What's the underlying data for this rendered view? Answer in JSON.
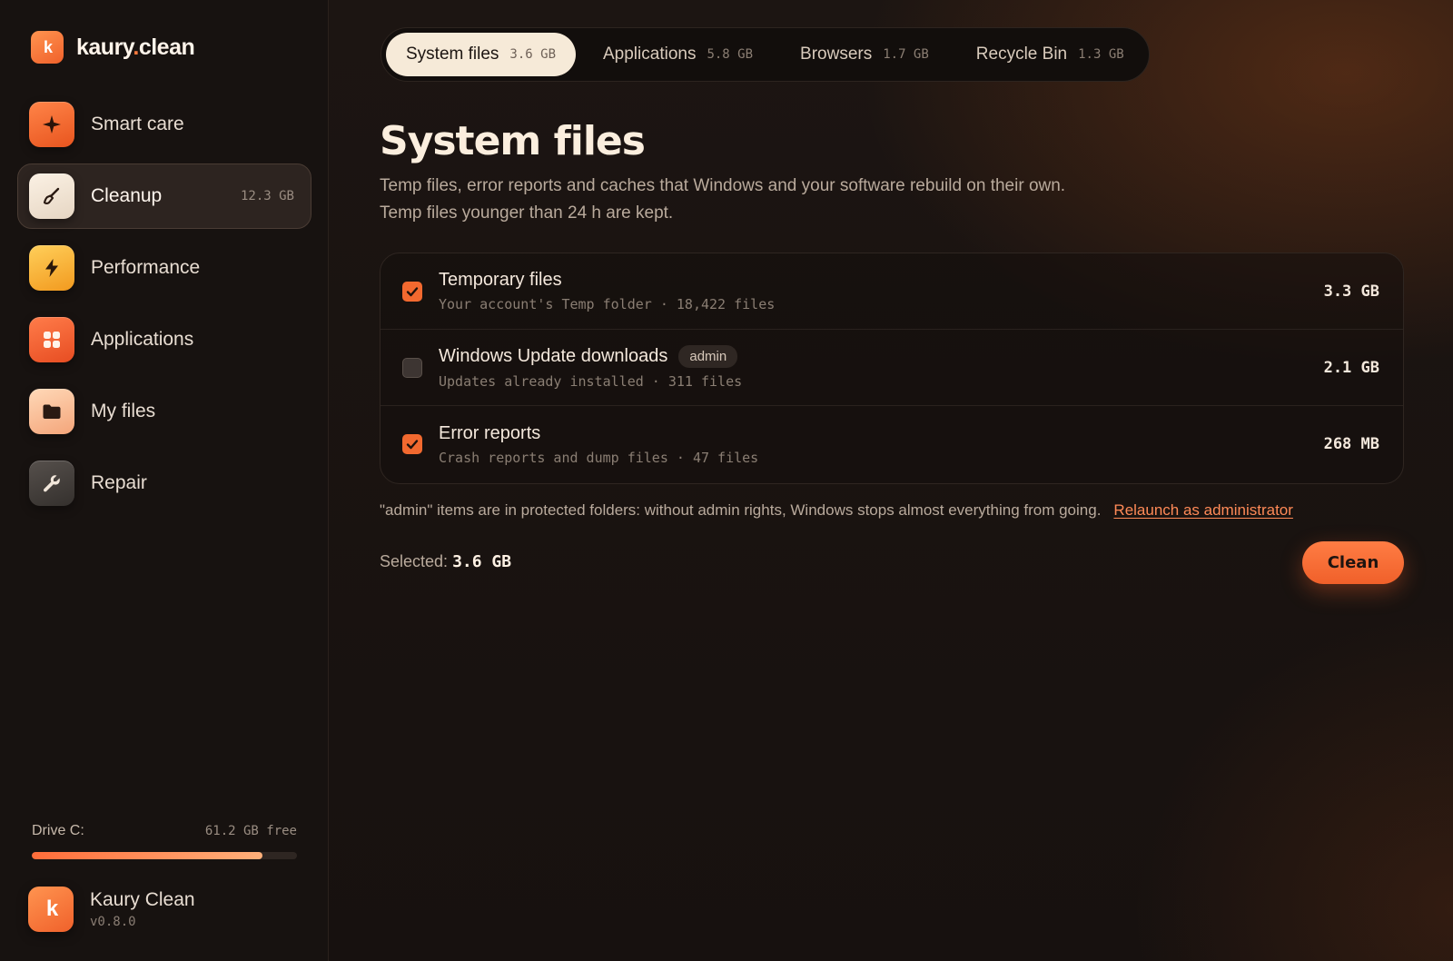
{
  "brand": {
    "logo_text": "k",
    "name_part1": "kaury",
    "name_dot": ".",
    "name_part2": "clean"
  },
  "sidebar": {
    "items": [
      {
        "label": "Smart care",
        "icon": "sparkle-icon",
        "badge": ""
      },
      {
        "label": "Cleanup",
        "icon": "broom-icon",
        "badge": "12.3 GB",
        "active": true
      },
      {
        "label": "Performance",
        "icon": "lightning-icon",
        "badge": ""
      },
      {
        "label": "Applications",
        "icon": "apps-grid-icon",
        "badge": ""
      },
      {
        "label": "My files",
        "icon": "folder-icon",
        "badge": ""
      },
      {
        "label": "Repair",
        "icon": "wrench-icon",
        "badge": ""
      }
    ],
    "drive": {
      "label": "Drive C:",
      "free": "61.2 GB free",
      "used_fraction": 0.87
    },
    "footer": {
      "app_name": "Kaury Clean",
      "version": "v0.8.0"
    }
  },
  "tabs": [
    {
      "label": "System files",
      "size": "3.6 GB",
      "active": true
    },
    {
      "label": "Applications",
      "size": "5.8 GB"
    },
    {
      "label": "Browsers",
      "size": "1.7 GB"
    },
    {
      "label": "Recycle Bin",
      "size": "1.3 GB"
    }
  ],
  "main": {
    "title": "System files",
    "description": "Temp files, error reports and caches that Windows and your software rebuild on their own. Temp files younger than 24 h are kept.",
    "items": [
      {
        "title": "Temporary files",
        "subtitle": "Your account's Temp folder · 18,422 files",
        "size": "3.3 GB",
        "checked": true,
        "tag": ""
      },
      {
        "title": "Windows Update downloads",
        "subtitle": "Updates already installed · 311 files",
        "size": "2.1 GB",
        "checked": false,
        "tag": "admin"
      },
      {
        "title": "Error reports",
        "subtitle": "Crash reports and dump files · 47 files",
        "size": "268 MB",
        "checked": true,
        "tag": ""
      }
    ],
    "note": "\"admin\" items are in protected folders: without admin rights, Windows stops almost everything from going.",
    "note_link": "Relaunch as administrator",
    "selected_label": "Selected:",
    "selected_value": "3.6 GB",
    "clean_button": "Clean"
  },
  "colors": {
    "accent": "#f2692f",
    "link": "#ff8a57",
    "tab_active_bg": "#f6ead8"
  }
}
